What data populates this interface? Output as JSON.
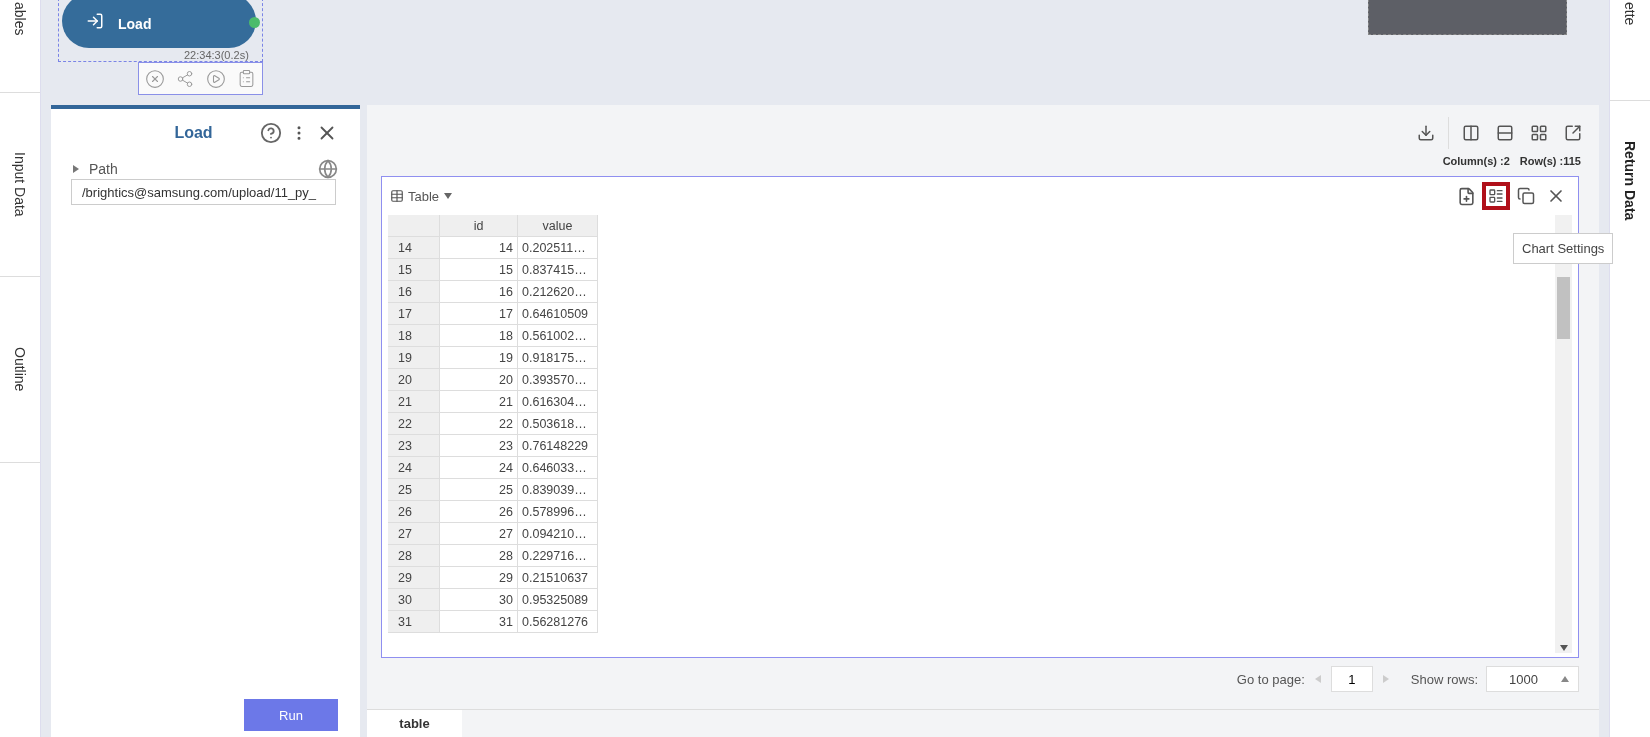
{
  "left_tabs": [
    {
      "label": "ables"
    },
    {
      "label": "Input Data"
    },
    {
      "label": "Outline"
    }
  ],
  "canvas": {
    "node": {
      "label": "Load",
      "time": "22:34:3(0.2s)",
      "selected": true
    }
  },
  "right_tabs": [
    {
      "label": "ette"
    },
    {
      "label": "Return Data"
    }
  ],
  "properties_panel": {
    "title": "Load",
    "section": {
      "label": "Path",
      "expanded": false
    },
    "path_value": "/brightics@samsung.com/upload/11_py_",
    "run_button": "Run"
  },
  "result_panel": {
    "columns_count": "Column(s) :2",
    "rows_count": "Row(s) :115",
    "table_view": {
      "view": "Table",
      "tools": [
        {
          "kind": "add-sheet",
          "highlighted": false
        },
        {
          "kind": "chart-settings",
          "highlighted": true
        },
        {
          "kind": "copy",
          "highlighted": false
        },
        {
          "kind": "close",
          "highlighted": false
        }
      ],
      "tooltip": "Chart Settings",
      "columns": [
        "",
        "id",
        "value"
      ],
      "rows": [
        [
          "14",
          "14",
          "0.202511…"
        ],
        [
          "15",
          "15",
          "0.837415…"
        ],
        [
          "16",
          "16",
          "0.212620…"
        ],
        [
          "17",
          "17",
          "0.64610509"
        ],
        [
          "18",
          "18",
          "0.561002…"
        ],
        [
          "19",
          "19",
          "0.918175…"
        ],
        [
          "20",
          "20",
          "0.393570…"
        ],
        [
          "21",
          "21",
          "0.616304…"
        ],
        [
          "22",
          "22",
          "0.503618…"
        ],
        [
          "23",
          "23",
          "0.76148229"
        ],
        [
          "24",
          "24",
          "0.646033…"
        ],
        [
          "25",
          "25",
          "0.839039…"
        ],
        [
          "26",
          "26",
          "0.578996…"
        ],
        [
          "27",
          "27",
          "0.094210…"
        ],
        [
          "28",
          "28",
          "0.229716…"
        ],
        [
          "29",
          "29",
          "0.21510637"
        ],
        [
          "30",
          "30",
          "0.95325089"
        ],
        [
          "31",
          "31",
          "0.56281276"
        ]
      ]
    },
    "pagination": {
      "page_label": "Go to page:",
      "page": "1",
      "rows_label": "Show rows:",
      "rows_per_page": "1000"
    },
    "bottom_tabs": [
      {
        "label": "table",
        "selected": true
      }
    ]
  }
}
